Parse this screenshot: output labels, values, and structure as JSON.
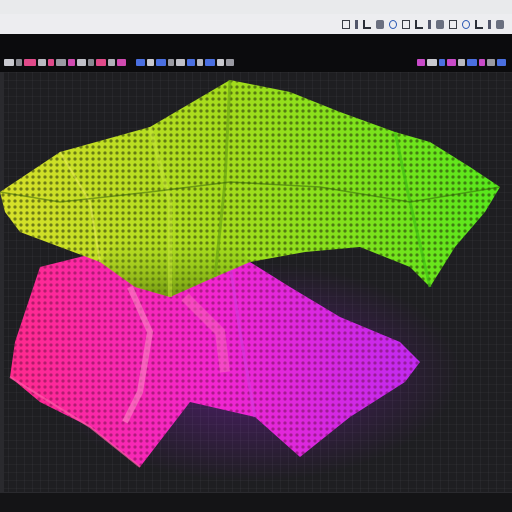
{
  "window": {
    "title": ""
  },
  "menu": {
    "items": []
  },
  "toolbar": {
    "groups": [
      {
        "name": "tool-group-left",
        "color": "#e04a8a"
      },
      {
        "name": "tool-group-mid",
        "color": "#4a6fe0"
      },
      {
        "name": "tool-group-right",
        "color": "#c84ac8"
      }
    ],
    "icons": [
      "frame-icon",
      "bar-icon",
      "corner-icon",
      "block-icon",
      "circle-icon",
      "frame-icon",
      "bar-icon",
      "block-icon",
      "corner-icon",
      "circle-icon",
      "frame-icon",
      "bar-icon"
    ]
  },
  "viewport": {
    "background": "#1e1e21",
    "grid_color": "#3a3a40",
    "upper_mesh": {
      "name": "upper-mesh-object",
      "colors": [
        "#d8e02a",
        "#8ee018",
        "#56e81c"
      ]
    },
    "lower_mesh": {
      "name": "lower-mesh-object",
      "colors": [
        "#ff2a8c",
        "#f226d0",
        "#c02af0"
      ]
    }
  },
  "status": {
    "text": ""
  }
}
